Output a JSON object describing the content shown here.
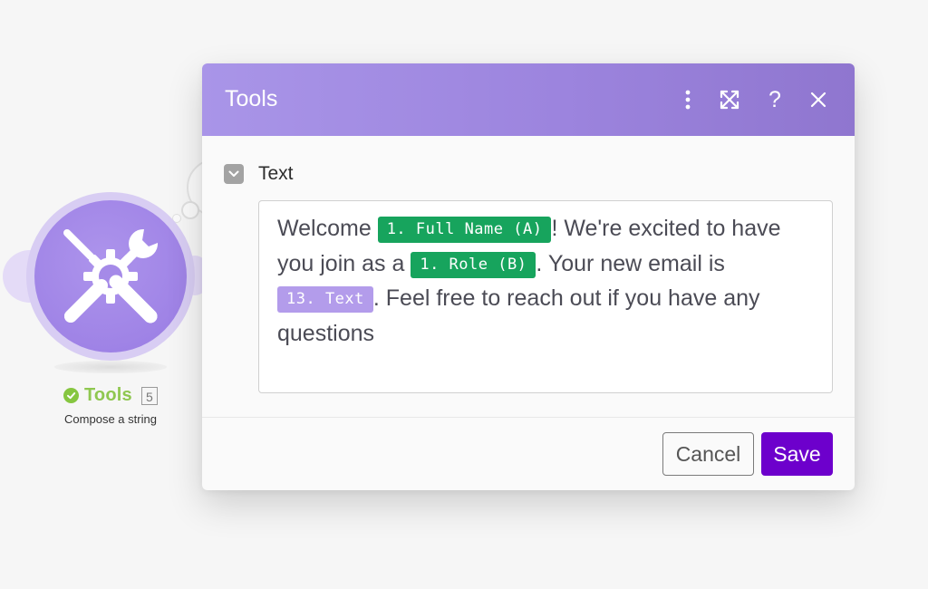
{
  "module": {
    "icon": "tools-icon",
    "status_icon": "check-circle-icon",
    "title": "Tools",
    "badge": "5",
    "subtitle": "Compose a string"
  },
  "dialog": {
    "title": "Tools",
    "header_buttons": {
      "more": "more-vertical-icon",
      "expand": "expand-icon",
      "help": "?",
      "close": "close-icon"
    },
    "field": {
      "label": "Text",
      "toggle_icon": "chevron-down-icon",
      "content": {
        "seg1": "Welcome ",
        "pill1": "1. Full Name (A)",
        "seg2": "! We're excited to have you join as a ",
        "pill2": "1. Role (B)",
        "seg3": ". Your new email is ",
        "pill3": "13. Text",
        "seg4": ". Feel free to reach out if you have any questions"
      }
    },
    "footer": {
      "cancel_label": "Cancel",
      "save_label": "Save"
    }
  },
  "colors": {
    "header_gradient_start": "#a995e8",
    "header_gradient_end": "#8f76cf",
    "save_button": "#6d00cc",
    "pill_green": "#17a45d",
    "pill_purple": "#b39ceb",
    "module_circle": "#9f83e6",
    "status_green": "#86c640"
  }
}
